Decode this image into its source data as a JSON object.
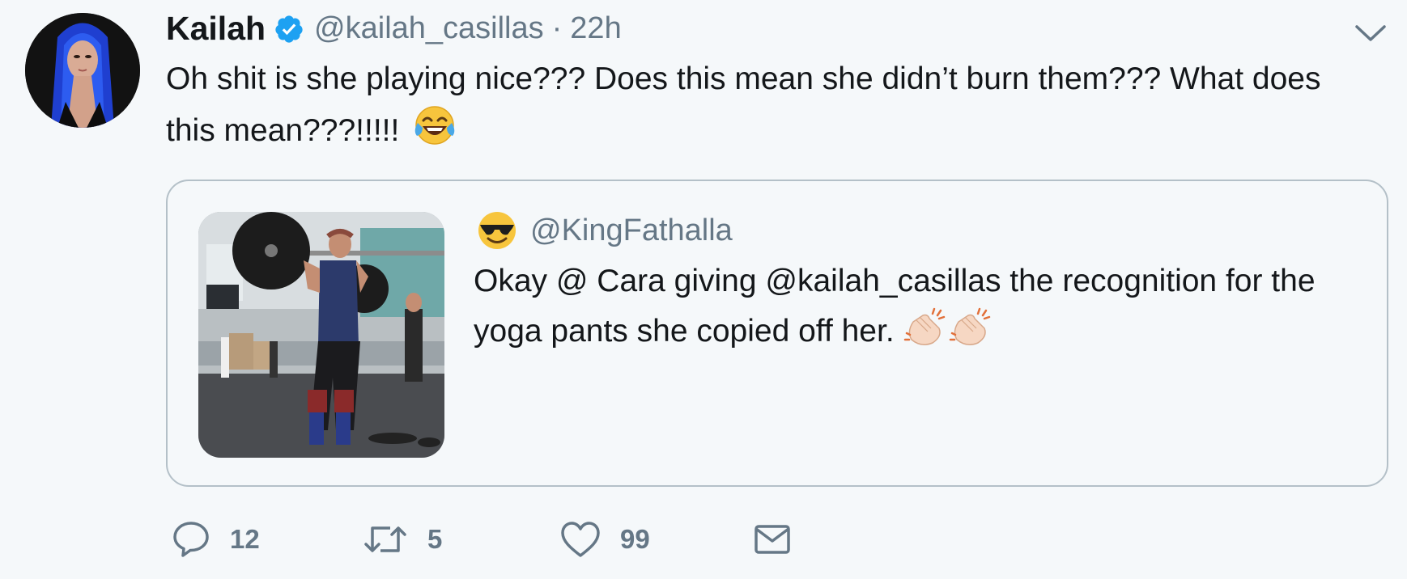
{
  "tweet": {
    "author_name": "Kailah",
    "verified": true,
    "handle": "@kailah_casillas",
    "separator": "·",
    "time": "22h",
    "text": "Oh shit is she playing nice??? Does this mean she didn’t burn them??? What does this mean???!!!!!",
    "text_emoji": "face-with-tears-of-joy-icon"
  },
  "quoted_tweet": {
    "author_emoji": "smiling-face-with-sunglasses-icon",
    "handle": "@KingFathalla",
    "text": "Okay @ Cara giving @kailah_casillas the recognition for the yoga pants she copied off her.",
    "text_emoji": [
      "clapping-hands-icon",
      "clapping-hands-icon"
    ]
  },
  "actions": {
    "reply_count": "12",
    "retweet_count": "5",
    "like_count": "99"
  },
  "colors": {
    "background": "#f5f8fa",
    "text": "#14171a",
    "secondary": "#657786",
    "verified_blue": "#1da1f2",
    "quote_border": "#b4c0c8"
  }
}
